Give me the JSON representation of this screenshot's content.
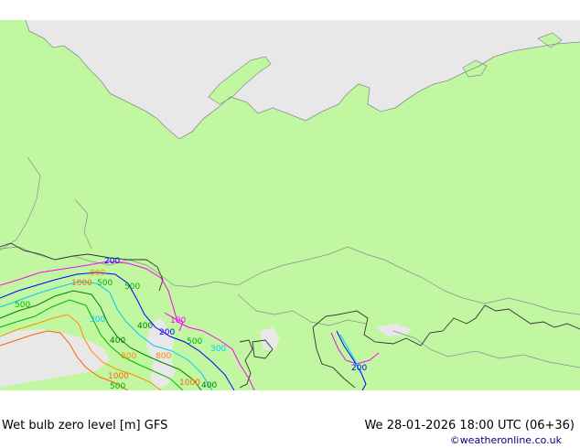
{
  "footer": {
    "product": "Wet bulb zero level [m] GFS",
    "valid_time": "We 28-01-2026 18:00 UTC (06+36)",
    "credit": "©weatheronline.co.uk"
  },
  "colors": {
    "land": "#c2f7a2",
    "sea": "#e8e8e8",
    "border": "#8c8c8c",
    "coast": "#8c8c8c",
    "contour_100": "#ff00ff",
    "contour_200": "#0000ff",
    "contour_300": "#00c8ff",
    "contour_400": "#008000",
    "contour_500": "#00b400",
    "contour_800": "#ff8c00",
    "contour_1000": "#ff6400"
  },
  "contour_labels": [
    {
      "text": "200",
      "color": "contour_200"
    },
    {
      "text": "800",
      "color": "contour_800"
    },
    {
      "text": "500",
      "color": "contour_500"
    },
    {
      "text": "1000",
      "color": "contour_1000"
    },
    {
      "text": "500",
      "color": "contour_500"
    },
    {
      "text": "500",
      "color": "contour_500"
    },
    {
      "text": "300",
      "color": "contour_300"
    },
    {
      "text": "400",
      "color": "contour_400"
    },
    {
      "text": "200",
      "color": "contour_200"
    },
    {
      "text": "100",
      "color": "contour_100"
    },
    {
      "text": "400",
      "color": "contour_400"
    },
    {
      "text": "500",
      "color": "contour_500"
    },
    {
      "text": "800",
      "color": "contour_800"
    },
    {
      "text": "800",
      "color": "contour_800"
    },
    {
      "text": "300",
      "color": "contour_300"
    },
    {
      "text": "1000",
      "color": "contour_1000"
    },
    {
      "text": "1000",
      "color": "contour_1000"
    },
    {
      "text": "400",
      "color": "contour_400"
    },
    {
      "text": "500",
      "color": "contour_500"
    },
    {
      "text": "200",
      "color": "contour_200"
    }
  ]
}
